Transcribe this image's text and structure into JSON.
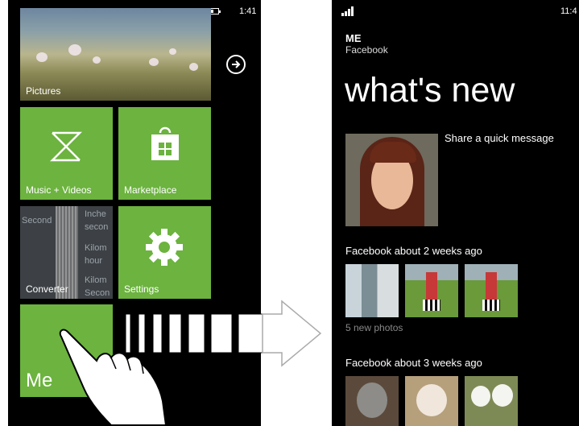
{
  "left_phone": {
    "status": {
      "battery": "battery-icon",
      "time": "1:41"
    },
    "tiles": {
      "pictures": "Pictures",
      "music_videos": "Music + Videos",
      "marketplace": "Marketplace",
      "converter": "Converter",
      "settings": "Settings",
      "me": "Me"
    },
    "converter_bg_text": [
      "Second",
      "Inche",
      "secon",
      "Kilom",
      "hour",
      "Kilom",
      "Secon"
    ]
  },
  "right_phone": {
    "status": {
      "signal": "signal-icon",
      "time": "11:4"
    },
    "profile_name": "ME",
    "profile_source": "Facebook",
    "page_title": "what's new",
    "share_message": "Share a quick message",
    "feed": [
      {
        "header": "Facebook about 2 weeks ago",
        "caption": "5 new photos"
      },
      {
        "header": "Facebook about 3 weeks ago"
      }
    ]
  },
  "colors": {
    "tile_green": "#6cb33f",
    "background": "#000000"
  }
}
